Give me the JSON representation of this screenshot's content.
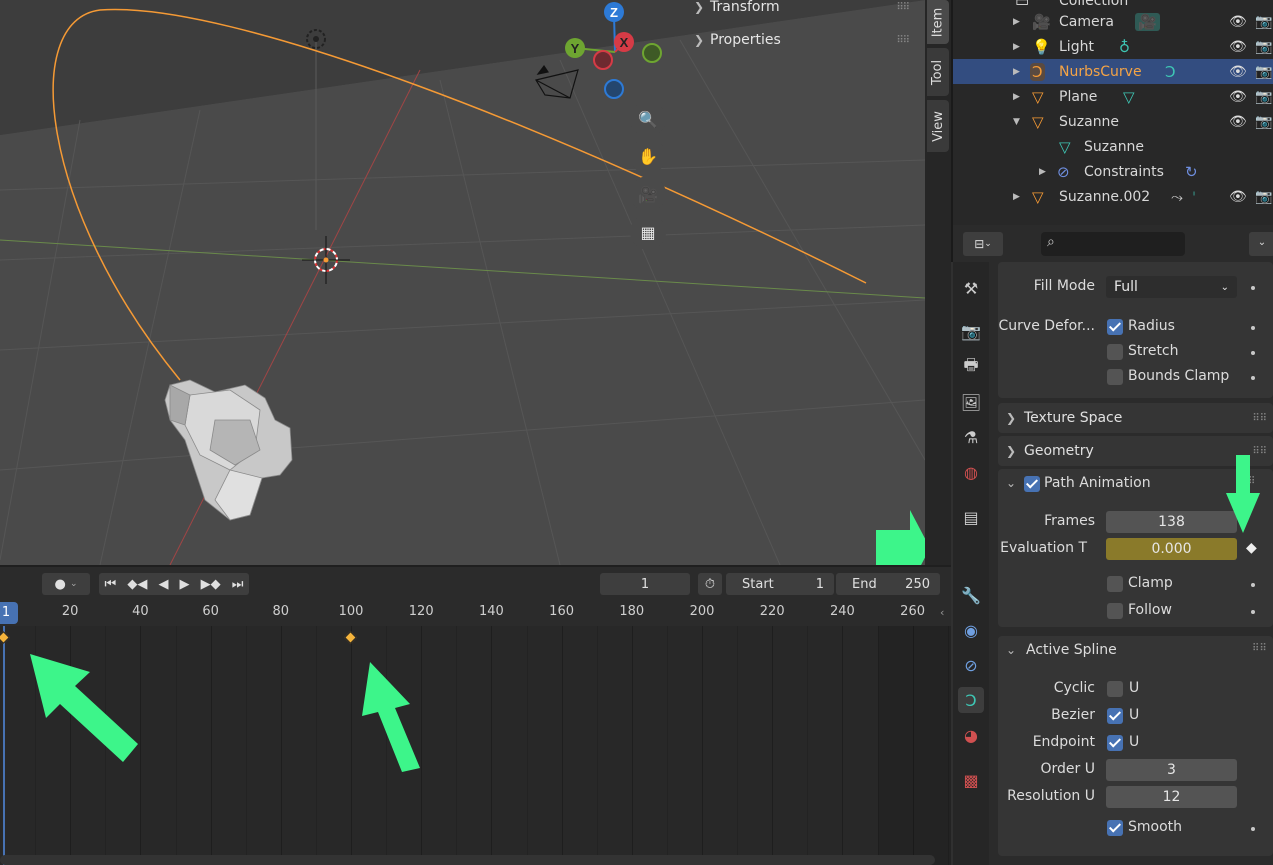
{
  "viewport": {
    "panels": [
      {
        "label": "Transform"
      },
      {
        "label": "Properties"
      }
    ],
    "gizmo": {
      "z": "Z",
      "y": "Y",
      "x": "X"
    },
    "side_tabs": [
      {
        "label": "Item"
      },
      {
        "label": "Tool"
      },
      {
        "label": "View"
      }
    ]
  },
  "outliner": {
    "items": [
      {
        "label": "Collection"
      },
      {
        "label": "Camera"
      },
      {
        "label": "Light"
      },
      {
        "label": "NurbsCurve"
      },
      {
        "label": "Plane"
      },
      {
        "label": "Suzanne"
      },
      {
        "label": "Suzanne"
      },
      {
        "label": "Constraints"
      },
      {
        "label": "Suzanne.002"
      }
    ]
  },
  "properties": {
    "fill_mode": {
      "label": "Fill Mode",
      "value": "Full"
    },
    "curve_deform": {
      "label": "Curve Defor...",
      "options": [
        {
          "label": "Radius",
          "checked": true
        },
        {
          "label": "Stretch",
          "checked": false
        },
        {
          "label": "Bounds Clamp",
          "checked": false
        }
      ]
    },
    "texture_space": "Texture Space",
    "geometry": "Geometry",
    "path_animation": {
      "title": "Path Animation",
      "frames_label": "Frames",
      "frames": "138",
      "eval_label": "Evaluation T",
      "eval_value": "0.000",
      "clamp": "Clamp",
      "follow": "Follow"
    },
    "active_spline": {
      "title": "Active Spline",
      "cyclic_label": "Cyclic",
      "bezier_label": "Bezier",
      "endpoint_label": "Endpoint",
      "u": "U",
      "order_label": "Order U",
      "order": "3",
      "resolution_label": "Resolution U",
      "resolution": "12",
      "smooth": "Smooth"
    }
  },
  "timeline": {
    "current_frame": "1",
    "start_label": "Start",
    "start": "1",
    "end_label": "End",
    "end": "250",
    "playhead": "1",
    "ticks": [
      "20",
      "40",
      "60",
      "80",
      "100",
      "120",
      "140",
      "160",
      "180",
      "200",
      "220",
      "240",
      "260"
    ],
    "keyframes": [
      1,
      100
    ]
  },
  "colors": {
    "accent": "#4772b3",
    "curve": "#f59a35",
    "keyframe": "#f5b43c",
    "annotation": "#3df58a",
    "eval_field": "#8a7a2a"
  }
}
